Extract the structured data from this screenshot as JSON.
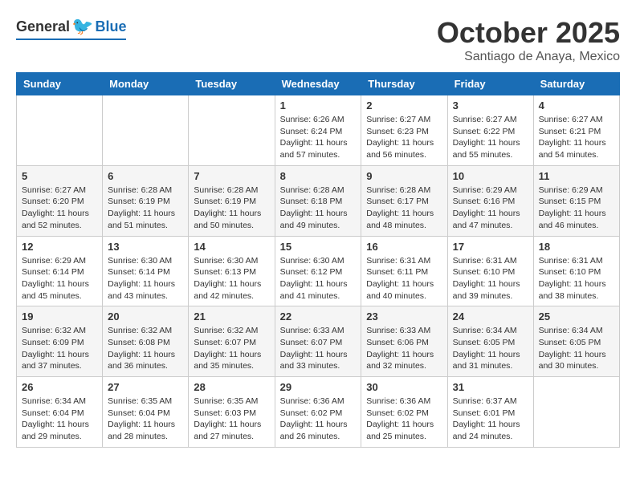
{
  "logo": {
    "general": "General",
    "blue": "Blue"
  },
  "title": {
    "month": "October 2025",
    "location": "Santiago de Anaya, Mexico"
  },
  "calendar": {
    "days_of_week": [
      "Sunday",
      "Monday",
      "Tuesday",
      "Wednesday",
      "Thursday",
      "Friday",
      "Saturday"
    ],
    "weeks": [
      [
        {
          "day": "",
          "info": ""
        },
        {
          "day": "",
          "info": ""
        },
        {
          "day": "",
          "info": ""
        },
        {
          "day": "1",
          "info": "Sunrise: 6:26 AM\nSunset: 6:24 PM\nDaylight: 11 hours and 57 minutes."
        },
        {
          "day": "2",
          "info": "Sunrise: 6:27 AM\nSunset: 6:23 PM\nDaylight: 11 hours and 56 minutes."
        },
        {
          "day": "3",
          "info": "Sunrise: 6:27 AM\nSunset: 6:22 PM\nDaylight: 11 hours and 55 minutes."
        },
        {
          "day": "4",
          "info": "Sunrise: 6:27 AM\nSunset: 6:21 PM\nDaylight: 11 hours and 54 minutes."
        }
      ],
      [
        {
          "day": "5",
          "info": "Sunrise: 6:27 AM\nSunset: 6:20 PM\nDaylight: 11 hours and 52 minutes."
        },
        {
          "day": "6",
          "info": "Sunrise: 6:28 AM\nSunset: 6:19 PM\nDaylight: 11 hours and 51 minutes."
        },
        {
          "day": "7",
          "info": "Sunrise: 6:28 AM\nSunset: 6:19 PM\nDaylight: 11 hours and 50 minutes."
        },
        {
          "day": "8",
          "info": "Sunrise: 6:28 AM\nSunset: 6:18 PM\nDaylight: 11 hours and 49 minutes."
        },
        {
          "day": "9",
          "info": "Sunrise: 6:28 AM\nSunset: 6:17 PM\nDaylight: 11 hours and 48 minutes."
        },
        {
          "day": "10",
          "info": "Sunrise: 6:29 AM\nSunset: 6:16 PM\nDaylight: 11 hours and 47 minutes."
        },
        {
          "day": "11",
          "info": "Sunrise: 6:29 AM\nSunset: 6:15 PM\nDaylight: 11 hours and 46 minutes."
        }
      ],
      [
        {
          "day": "12",
          "info": "Sunrise: 6:29 AM\nSunset: 6:14 PM\nDaylight: 11 hours and 45 minutes."
        },
        {
          "day": "13",
          "info": "Sunrise: 6:30 AM\nSunset: 6:14 PM\nDaylight: 11 hours and 43 minutes."
        },
        {
          "day": "14",
          "info": "Sunrise: 6:30 AM\nSunset: 6:13 PM\nDaylight: 11 hours and 42 minutes."
        },
        {
          "day": "15",
          "info": "Sunrise: 6:30 AM\nSunset: 6:12 PM\nDaylight: 11 hours and 41 minutes."
        },
        {
          "day": "16",
          "info": "Sunrise: 6:31 AM\nSunset: 6:11 PM\nDaylight: 11 hours and 40 minutes."
        },
        {
          "day": "17",
          "info": "Sunrise: 6:31 AM\nSunset: 6:10 PM\nDaylight: 11 hours and 39 minutes."
        },
        {
          "day": "18",
          "info": "Sunrise: 6:31 AM\nSunset: 6:10 PM\nDaylight: 11 hours and 38 minutes."
        }
      ],
      [
        {
          "day": "19",
          "info": "Sunrise: 6:32 AM\nSunset: 6:09 PM\nDaylight: 11 hours and 37 minutes."
        },
        {
          "day": "20",
          "info": "Sunrise: 6:32 AM\nSunset: 6:08 PM\nDaylight: 11 hours and 36 minutes."
        },
        {
          "day": "21",
          "info": "Sunrise: 6:32 AM\nSunset: 6:07 PM\nDaylight: 11 hours and 35 minutes."
        },
        {
          "day": "22",
          "info": "Sunrise: 6:33 AM\nSunset: 6:07 PM\nDaylight: 11 hours and 33 minutes."
        },
        {
          "day": "23",
          "info": "Sunrise: 6:33 AM\nSunset: 6:06 PM\nDaylight: 11 hours and 32 minutes."
        },
        {
          "day": "24",
          "info": "Sunrise: 6:34 AM\nSunset: 6:05 PM\nDaylight: 11 hours and 31 minutes."
        },
        {
          "day": "25",
          "info": "Sunrise: 6:34 AM\nSunset: 6:05 PM\nDaylight: 11 hours and 30 minutes."
        }
      ],
      [
        {
          "day": "26",
          "info": "Sunrise: 6:34 AM\nSunset: 6:04 PM\nDaylight: 11 hours and 29 minutes."
        },
        {
          "day": "27",
          "info": "Sunrise: 6:35 AM\nSunset: 6:04 PM\nDaylight: 11 hours and 28 minutes."
        },
        {
          "day": "28",
          "info": "Sunrise: 6:35 AM\nSunset: 6:03 PM\nDaylight: 11 hours and 27 minutes."
        },
        {
          "day": "29",
          "info": "Sunrise: 6:36 AM\nSunset: 6:02 PM\nDaylight: 11 hours and 26 minutes."
        },
        {
          "day": "30",
          "info": "Sunrise: 6:36 AM\nSunset: 6:02 PM\nDaylight: 11 hours and 25 minutes."
        },
        {
          "day": "31",
          "info": "Sunrise: 6:37 AM\nSunset: 6:01 PM\nDaylight: 11 hours and 24 minutes."
        },
        {
          "day": "",
          "info": ""
        }
      ]
    ]
  }
}
